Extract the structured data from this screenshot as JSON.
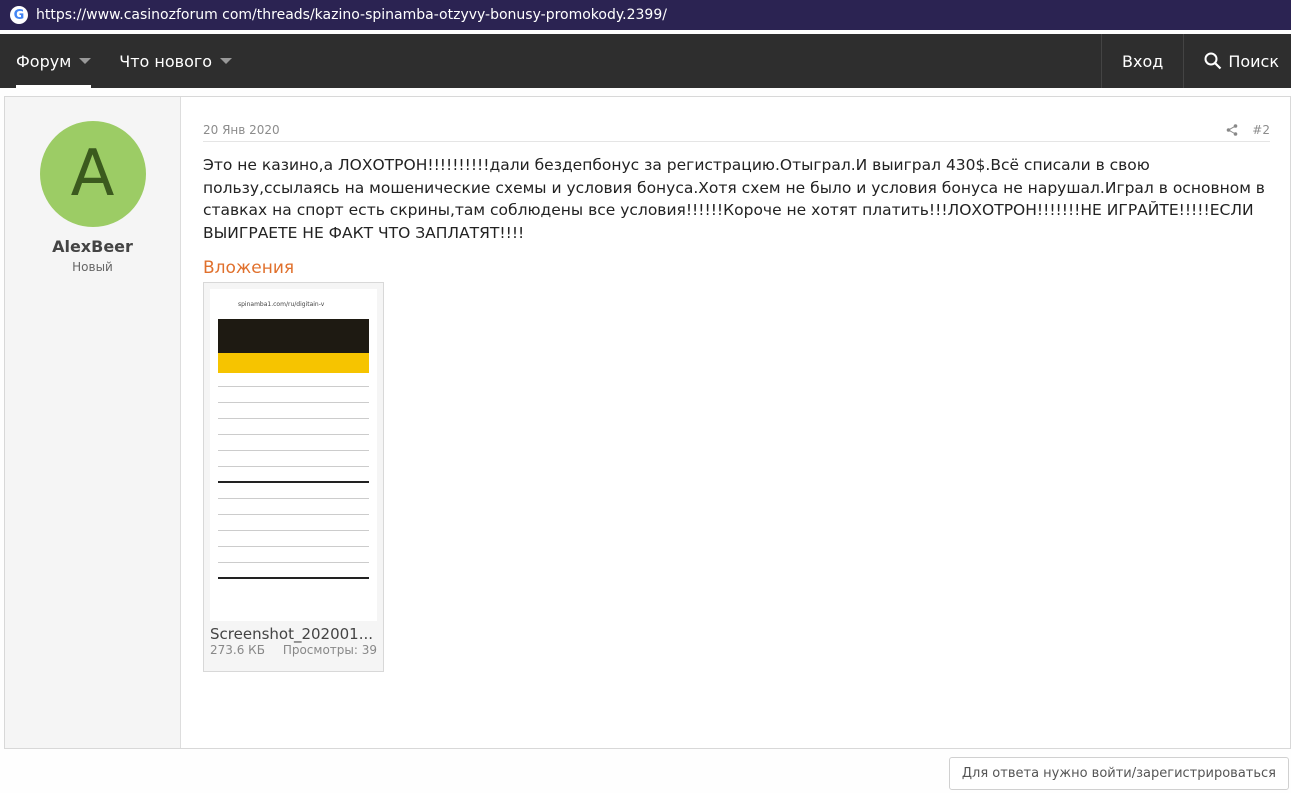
{
  "browser": {
    "url": "https://www.casinozforum com/threads/kazino-spinamba-otzyvy-bonusy-promokody.2399/"
  },
  "nav": {
    "items": [
      {
        "label": "Форум"
      },
      {
        "label": "Что нового"
      }
    ],
    "login": "Вход",
    "search": "Поиск"
  },
  "post": {
    "user": {
      "initial": "A",
      "name": "AlexBeer",
      "title": "Новый"
    },
    "date": "20 Янв 2020",
    "number": "#2",
    "text": "Это не казино,а ЛОХОТРОН!!!!!!!!!!дали бездепбонус за регистрацию.Отыграл.И выиграл 430$.Всё списали в свою пользу,ссылаясь на мошенические схемы и условия бонуса.Хотя схем не было и условия бонуса не нарушал.Играл в основном в ставках на спорт есть скрины,там соблюдены все условия!!!!!!Короче не хотят платить!!!ЛОХОТРОН!!!!!!!НЕ ИГРАЙТЕ!!!!!ЕСЛИ ВЫИГРАЕТЕ НЕ ФАКТ ЧТО ЗАПЛАТЯТ!!!!",
    "attachments_heading": "Вложения",
    "attachment": {
      "filename": "Screenshot_202001...",
      "size": "273.6 КБ",
      "views": "Просмотры: 39",
      "thumb_url": "spinamba1.com/ru/digitain-v"
    }
  },
  "reply_button": "Для ответа нужно войти/зарегистрироваться"
}
